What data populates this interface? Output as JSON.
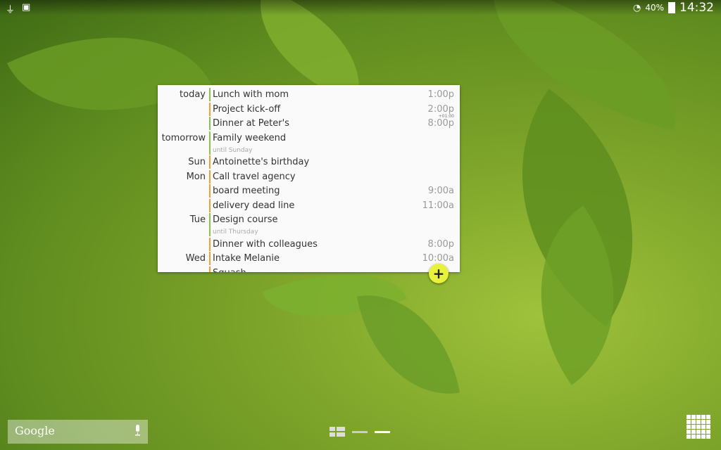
{
  "status_bar": {
    "left_icons": [
      "usb-icon",
      "image-icon"
    ],
    "battery": "40%",
    "time": "14:32"
  },
  "agenda": {
    "rows": [
      {
        "day": "today",
        "title": "Lunch with mom",
        "time": "1:00p",
        "color": "#8bc34a"
      },
      {
        "day": "",
        "title": "Project kick-off",
        "time": "2:00p",
        "color": "#f0a030"
      },
      {
        "day": "",
        "title": "Dinner at Peter's",
        "time": "8:00p",
        "extra": "+01:00",
        "color": "#8bc34a"
      },
      {
        "day": "tomorrow",
        "title": "Family weekend",
        "time": "",
        "sub": "until Sunday",
        "color": "#8bc34a"
      },
      {
        "day": "Sun",
        "title": "Antoinette's birthday",
        "time": "",
        "color": "#f0a030"
      },
      {
        "day": "Mon",
        "title": "Call travel agency",
        "time": "",
        "color": "#f0a030"
      },
      {
        "day": "",
        "title": "board meeting",
        "time": "9:00a",
        "color": "#f0a030"
      },
      {
        "day": "",
        "title": "delivery dead line",
        "time": "11:00a",
        "color": "#f0a030"
      },
      {
        "day": "Tue",
        "title": "Design course",
        "time": "",
        "sub": "until Thursday",
        "color": "#8bc34a"
      },
      {
        "day": "",
        "title": "Dinner with colleagues",
        "time": "8:00p",
        "color": "#f0a030"
      },
      {
        "day": "Wed",
        "title": "Intake Melanie",
        "time": "10:00a",
        "color": "#f0a030"
      },
      {
        "day": "",
        "title": "Squash",
        "time": "",
        "color": "#f0a030"
      }
    ]
  },
  "fab": {
    "label": "+"
  },
  "search": {
    "label": "Google"
  }
}
